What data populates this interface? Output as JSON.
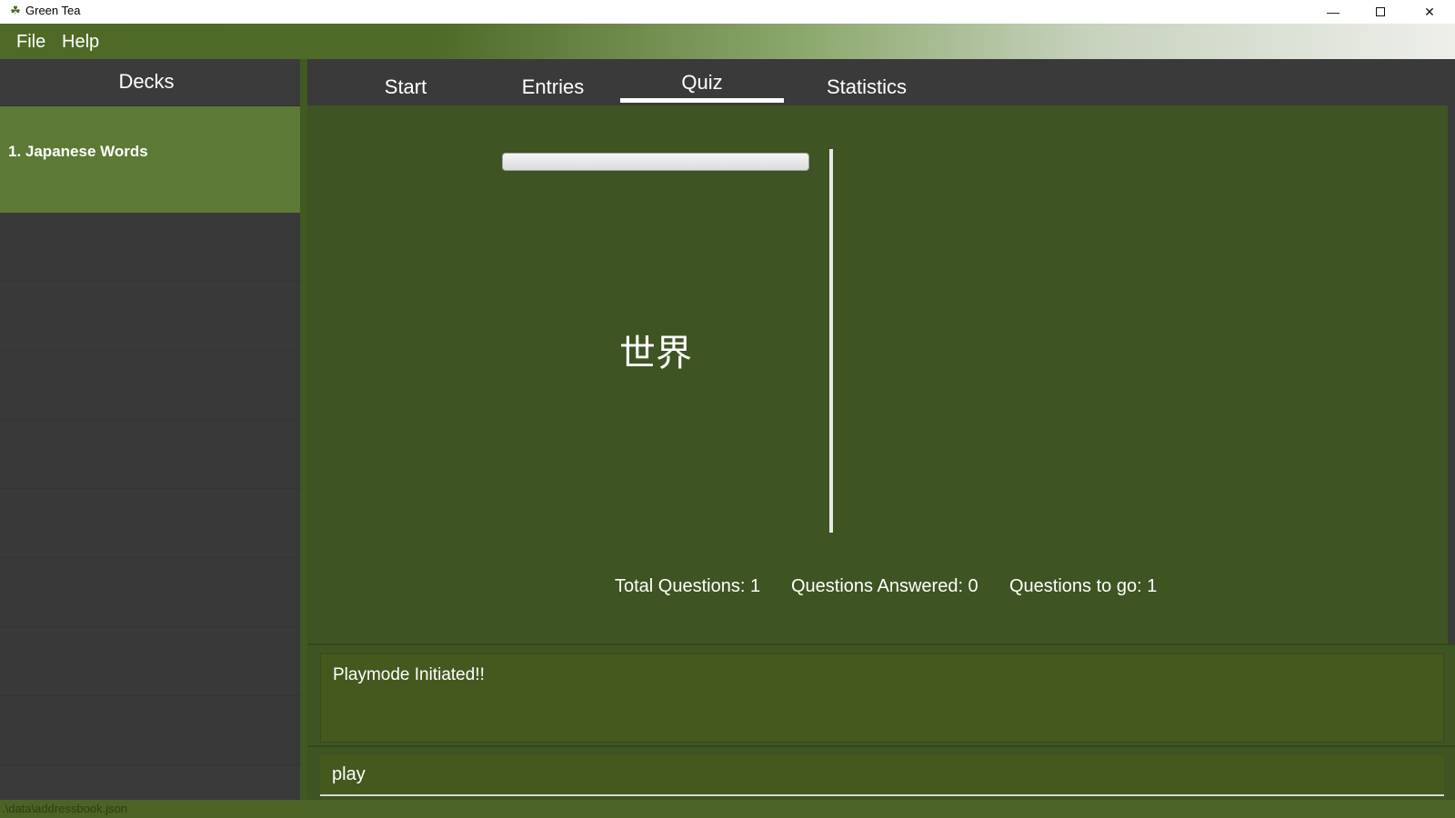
{
  "window": {
    "title": "Green Tea",
    "icon": "tea-leaf-icon",
    "minimize_glyph": "—",
    "close_glyph": "✕"
  },
  "menu": {
    "items": [
      {
        "label": "File"
      },
      {
        "label": "Help"
      }
    ]
  },
  "sidebar": {
    "title": "Decks",
    "decks": [
      {
        "label": "1.  Japanese Words"
      }
    ]
  },
  "tabs": [
    {
      "label": "Start"
    },
    {
      "label": "Entries"
    },
    {
      "label": "Quiz",
      "selected": true
    },
    {
      "label": "Statistics"
    }
  ],
  "quiz": {
    "question": "世界",
    "progress": 0,
    "stats": {
      "total": "Total Questions: 1",
      "answered": "Questions Answered: 0",
      "to_go": "Questions to go: 1"
    }
  },
  "result": {
    "text": "Playmode Initiated!!"
  },
  "command": {
    "value": "play"
  },
  "status_bar": {
    "path": ".\\data\\addressbook.json"
  },
  "colors": {
    "accent_green": "#5c7a35",
    "main_bg": "#3e5422",
    "sidebar_bg": "#3a3a3a"
  }
}
